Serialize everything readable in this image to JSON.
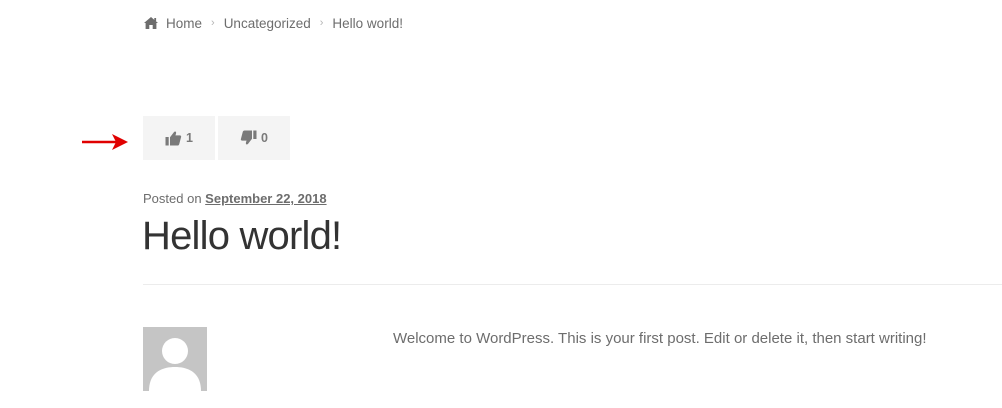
{
  "breadcrumb": {
    "home_icon": "home-icon",
    "items": [
      "Home",
      "Uncategorized",
      "Hello world!"
    ],
    "separator": "›"
  },
  "votes": {
    "like_icon": "thumbs-up-icon",
    "like_count": "1",
    "dislike_icon": "thumbs-down-icon",
    "dislike_count": "0"
  },
  "post": {
    "posted_prefix": "Posted on",
    "date": "September 22, 2018",
    "title": "Hello world!",
    "content": "Welcome to WordPress. This is your first post. Edit or delete it, then start writing!"
  },
  "colors": {
    "arrow": "#e00000",
    "button_bg": "#f4f4f4",
    "avatar_bg": "#c5c5c5",
    "text": "#6d6d6d",
    "title": "#333333"
  }
}
